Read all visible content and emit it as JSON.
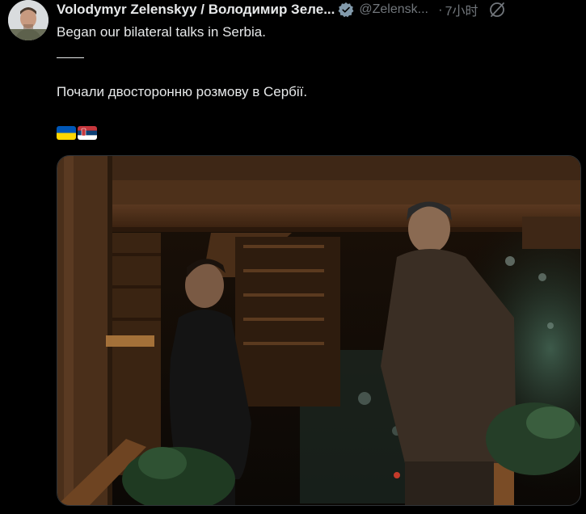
{
  "tweet": {
    "author_name": "Volodymyr Zelenskyy / Володимир Зеле...",
    "handle": "@Zelensk...",
    "separator": "·",
    "time": "7小时",
    "text_line_1": "Began our bilateral talks in Serbia.",
    "text_line_2": "Почали двосторонню розмову в Сербії.",
    "flags": [
      "ukraine-flag",
      "serbia-flag"
    ],
    "verified": true
  },
  "icons": {
    "verified": "verified-badge-icon",
    "grok": "grok-slash-circle-icon"
  },
  "colors": {
    "background": "#000000",
    "text": "#e7e9ea",
    "muted": "#71767b",
    "ukraine_blue": "#0057b7",
    "ukraine_yellow": "#ffd700",
    "serbia_red": "#c6363c",
    "serbia_blue": "#0c4076"
  }
}
